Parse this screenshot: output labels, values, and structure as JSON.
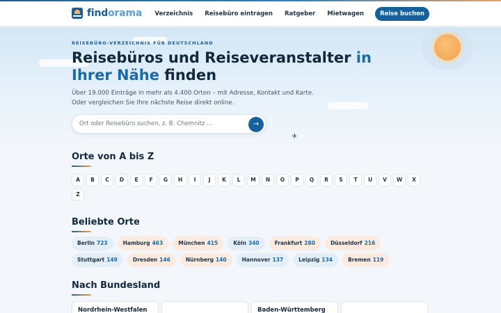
{
  "header": {
    "brand": {
      "part1": "find",
      "part2": "orama"
    },
    "nav": [
      "Verzeichnis",
      "Reisebüro eintragen",
      "Ratgeber",
      "Mietwagen"
    ],
    "cta": "Reise buchen"
  },
  "hero": {
    "eyebrow": "Reisebüro-Verzeichnis für Deutschland",
    "title_part1": "Reisebüros und Reiseveranstalter ",
    "title_highlight": "in Ihrer Nähe",
    "title_part2": " finden",
    "subtitle_line1": "Über 19.000 Einträge in mehr als 4.400 Orten – mit Adresse, Kontakt und Karte.",
    "subtitle_line2": "Oder vergleichen Sie Ihre nächste Reise direkt online.",
    "search_placeholder": "Ort oder Reisebüro suchen, z. B. Chemnitz …",
    "search_button_icon": "→",
    "plane_icon": "✈"
  },
  "az": {
    "title": "Orte von A bis Z",
    "letters": [
      "A",
      "B",
      "C",
      "D",
      "E",
      "F",
      "G",
      "H",
      "I",
      "J",
      "K",
      "L",
      "M",
      "N",
      "O",
      "P",
      "Q",
      "R",
      "S",
      "T",
      "U",
      "V",
      "W",
      "X",
      "Z"
    ]
  },
  "popular": {
    "title": "Beliebte Orte",
    "cities": [
      {
        "name": "Berlin",
        "count": "723",
        "tone": "blue"
      },
      {
        "name": "Hamburg",
        "count": "463",
        "tone": "peach"
      },
      {
        "name": "München",
        "count": "415",
        "tone": "peach"
      },
      {
        "name": "Köln",
        "count": "340",
        "tone": "blue"
      },
      {
        "name": "Frankfurt",
        "count": "280",
        "tone": "peach"
      },
      {
        "name": "Düsseldorf",
        "count": "216",
        "tone": "peach"
      },
      {
        "name": "Stuttgart",
        "count": "149",
        "tone": "blue"
      },
      {
        "name": "Dresden",
        "count": "146",
        "tone": "peach"
      },
      {
        "name": "Nürnberg",
        "count": "140",
        "tone": "peach"
      },
      {
        "name": "Hannover",
        "count": "137",
        "tone": "blue"
      },
      {
        "name": "Leipzig",
        "count": "134",
        "tone": "blue"
      },
      {
        "name": "Bremen",
        "count": "119",
        "tone": "peach"
      }
    ]
  },
  "states": {
    "title": "Nach Bundesland",
    "cards": [
      {
        "name": "Nordrhein-Westfalen",
        "count": ""
      },
      {
        "name": "",
        "count": ""
      },
      {
        "name": "Baden-Württemberg",
        "count": ""
      },
      {
        "name": "",
        "count": ""
      }
    ]
  },
  "colors": {
    "primary": "#17609c",
    "accent": "#f2a049",
    "highlight": "#1a6aa8"
  }
}
